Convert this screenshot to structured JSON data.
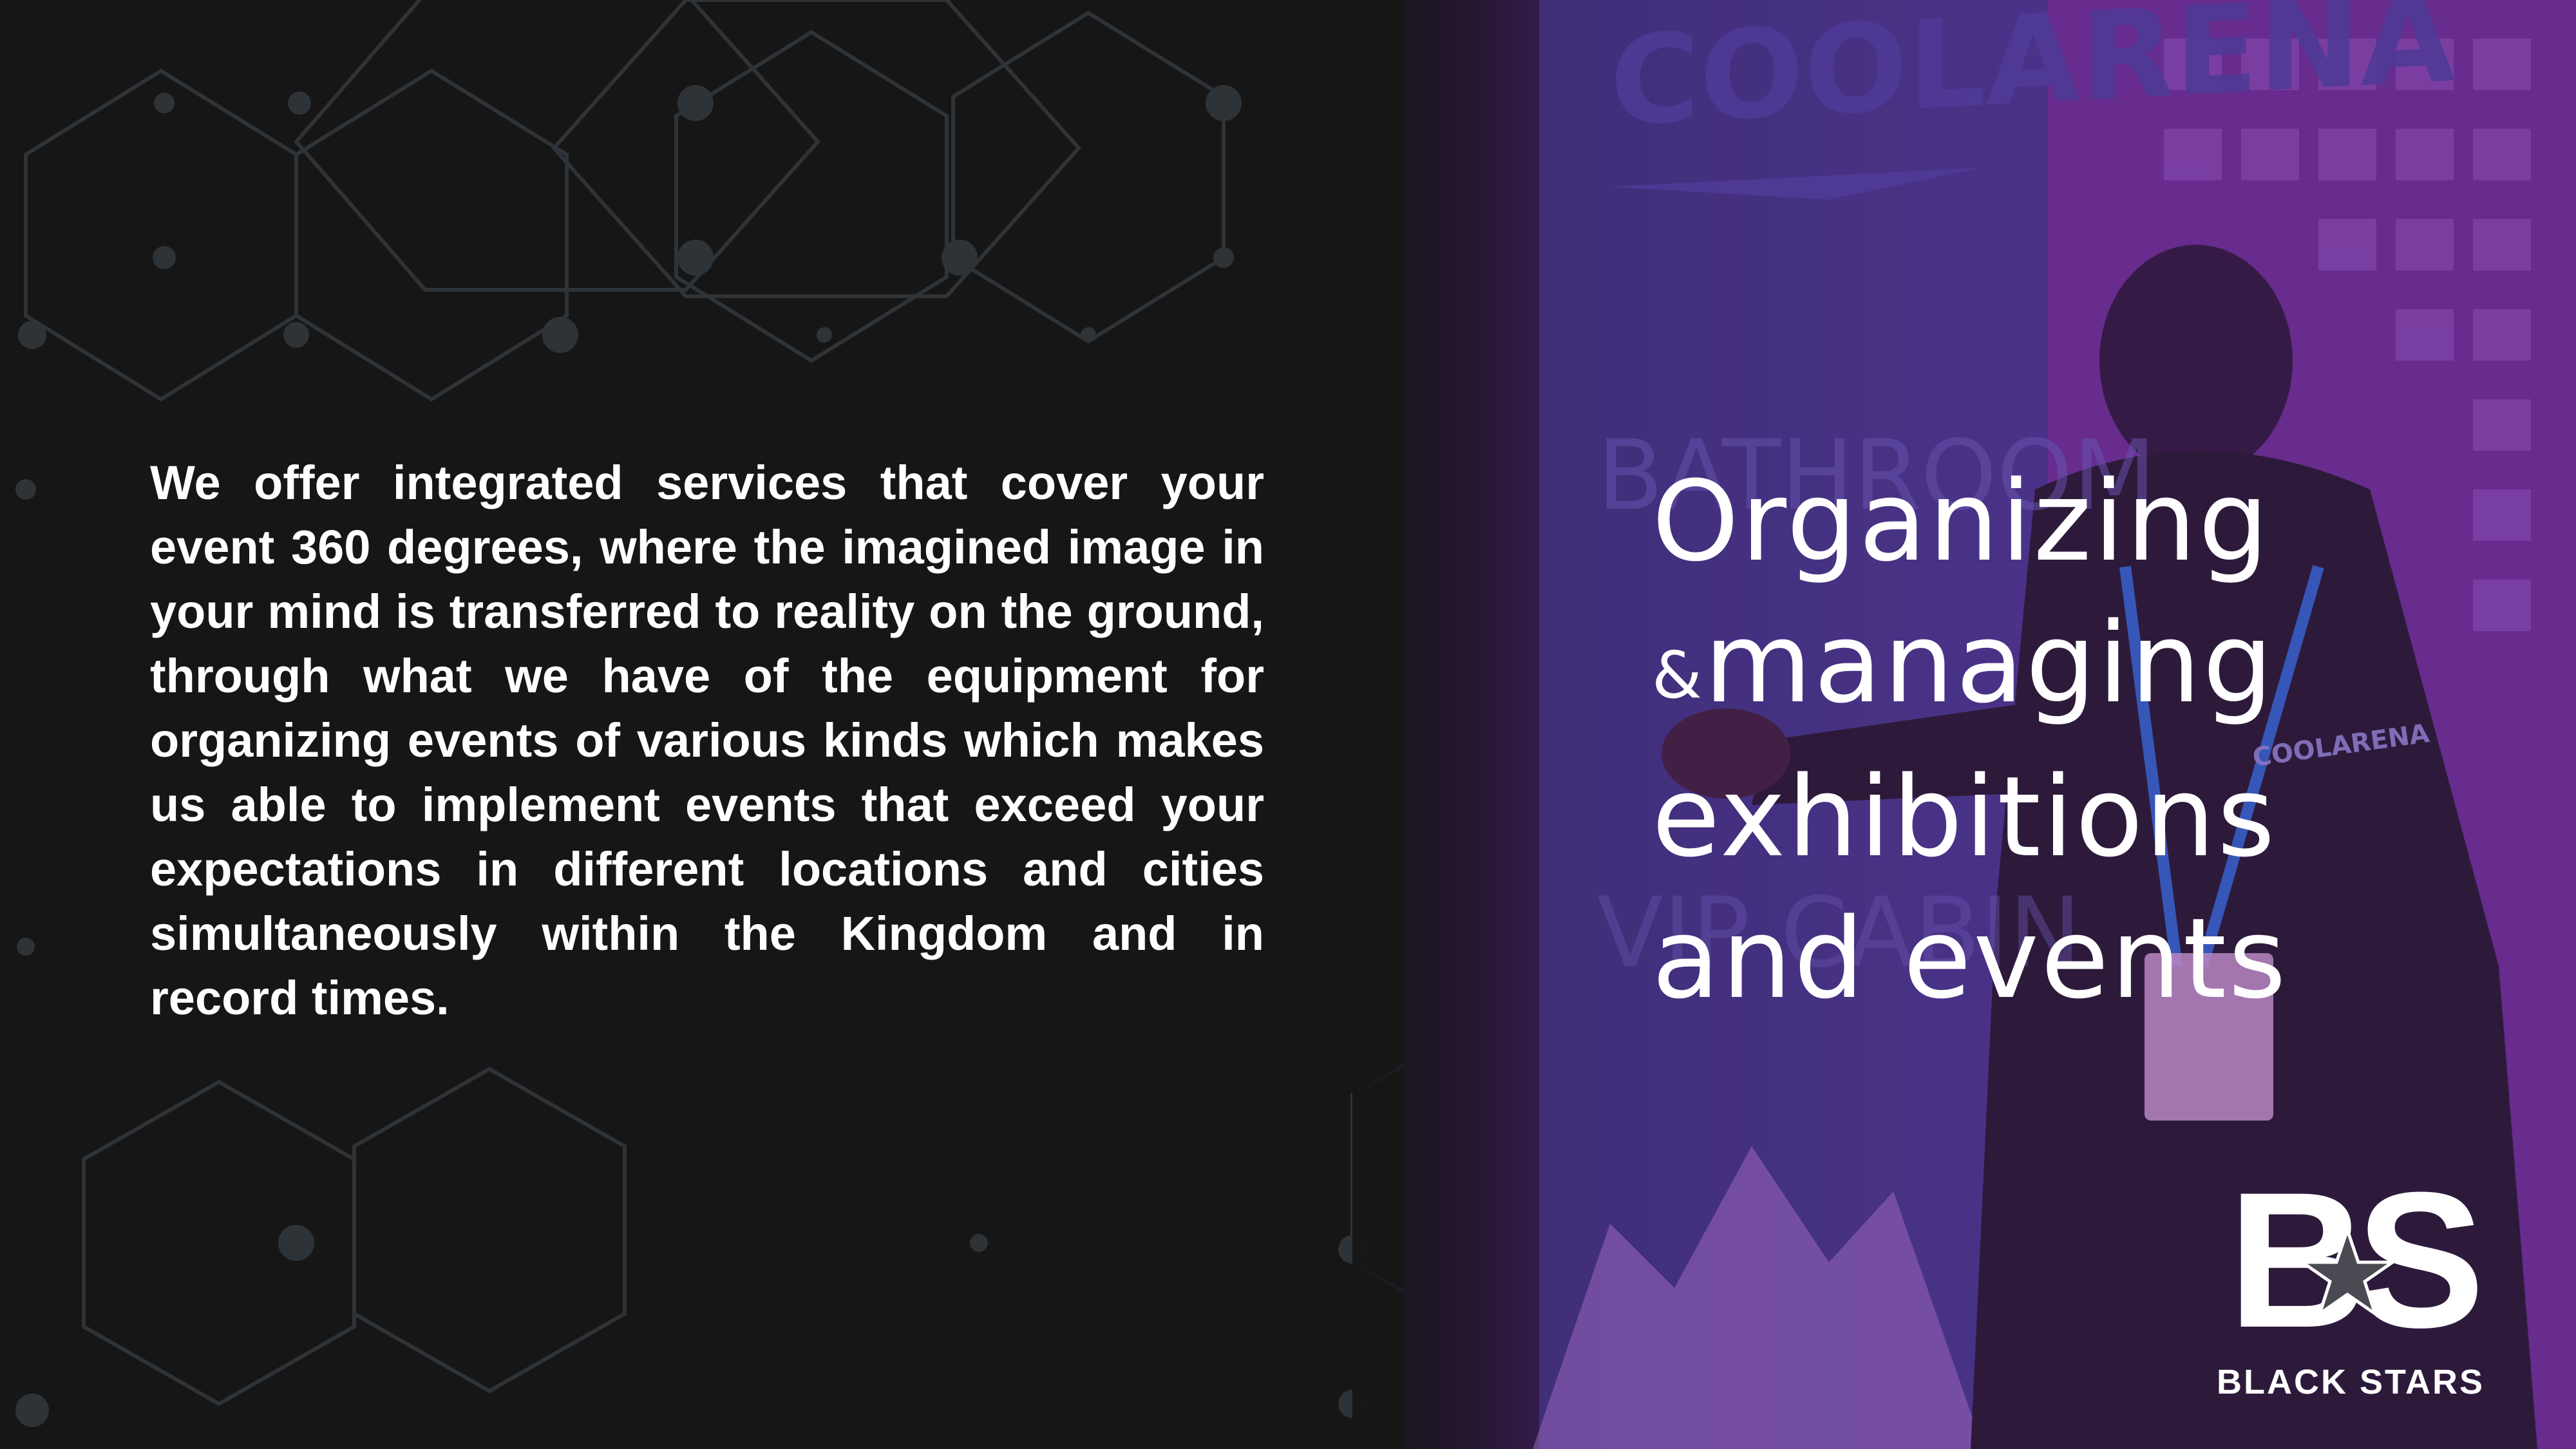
{
  "content": {
    "body_text": "We offer integrated services that cover your event 360 degrees, where the imagined image in your mind is transferred to reality on the ground, through what we have of the equipment for organizing events of various kinds which makes us able to implement events that exceed your expectations in different locations and cities simultaneously within the Kingdom and in record times."
  },
  "headline": {
    "line1": "Organizing",
    "amp": "&",
    "line2": "managing",
    "line3": "exhibitions",
    "line4": "and events"
  },
  "photo": {
    "sign_brand": "COOLARENA",
    "sign_direction": "BATHROOM",
    "sign_lower": "VIP CABIN",
    "badge_text": "COOLARENA"
  },
  "logo": {
    "monogram": "BS",
    "name": "BLACK STARS"
  },
  "colors": {
    "background": "#161616",
    "accent_purple": "#6b2f92",
    "text": "#ffffff"
  }
}
